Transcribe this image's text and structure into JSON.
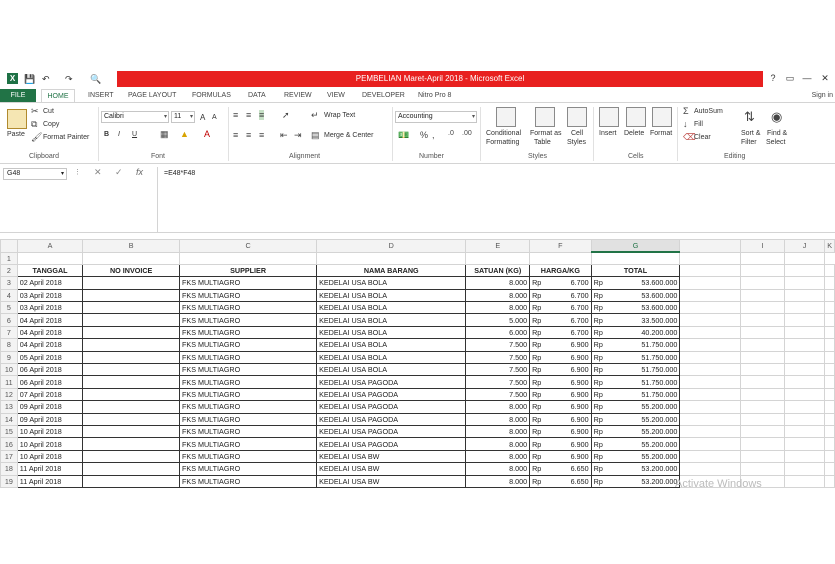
{
  "window": {
    "title": "PEMBELIAN Maret-April 2018 -  Microsoft Excel",
    "help": "?",
    "controls": {
      "restore": "▭",
      "minimize": "—",
      "maximize": "□",
      "close": "✕"
    }
  },
  "tabs": [
    "FILE",
    "HOME",
    "INSERT",
    "PAGE LAYOUT",
    "FORMULAS",
    "DATA",
    "REVIEW",
    "VIEW",
    "DEVELOPER",
    "Nitro Pro 8"
  ],
  "signin": "Sign in",
  "ribbon": {
    "clipboard": {
      "paste": "Paste",
      "cut": "Cut",
      "copy": "Copy",
      "format_painter": "Format Painter",
      "label": "Clipboard"
    },
    "font": {
      "name": "Calibri",
      "size": "11",
      "bold": "B",
      "italic": "I",
      "underline": "U",
      "grow": "A",
      "shrink": "A",
      "label": "Font"
    },
    "alignment": {
      "wrap": "Wrap Text",
      "merge": "Merge & Center",
      "label": "Alignment"
    },
    "number": {
      "format": "Accounting",
      "label": "Number"
    },
    "styles": {
      "conditional": "Conditional",
      "conditional2": "Formatting",
      "format_as": "Format as",
      "table": "Table",
      "cell": "Cell",
      "cell_styles": "Styles",
      "label": "Styles"
    },
    "cells": {
      "insert": "Insert",
      "delete": "Delete",
      "format": "Format",
      "label": "Cells"
    },
    "editing": {
      "autosum": "AutoSum",
      "fill": "Fill",
      "clear": "Clear",
      "sort": "Sort &",
      "filter": "Filter",
      "find": "Find &",
      "select": "Select",
      "label": "Editing"
    }
  },
  "formula_bar": {
    "name_box": "G48",
    "formula": "=E48*F48"
  },
  "columns": [
    "A",
    "B",
    "C",
    "D",
    "E",
    "F",
    "G",
    "I",
    "J",
    "K"
  ],
  "headers": {
    "tanggal": "TANGGAL",
    "invoice": "NO INVOICE",
    "supplier": "SUPPLIER",
    "barang": "NAMA BARANG",
    "satuan": "SATUAN (KG)",
    "harga": "HARGA/KG",
    "total": "TOTAL"
  },
  "currency": "Rp",
  "rows": [
    {
      "n": "3",
      "tanggal": "02 April 2018",
      "supplier": "FKS MULTIAGRO",
      "barang": "KEDELAI USA BOLA",
      "satuan": "8.000",
      "harga": "6.700",
      "total": "53.600.000"
    },
    {
      "n": "4",
      "tanggal": "03 April 2018",
      "supplier": "FKS MULTIAGRO",
      "barang": "KEDELAI USA BOLA",
      "satuan": "8.000",
      "harga": "6.700",
      "total": "53.600.000"
    },
    {
      "n": "5",
      "tanggal": "03 April 2018",
      "supplier": "FKS MULTIAGRO",
      "barang": "KEDELAI USA BOLA",
      "satuan": "8.000",
      "harga": "6.700",
      "total": "53.600.000"
    },
    {
      "n": "6",
      "tanggal": "04 April 2018",
      "supplier": "FKS MULTIAGRO",
      "barang": "KEDELAI USA BOLA",
      "satuan": "5.000",
      "harga": "6.700",
      "total": "33.500.000"
    },
    {
      "n": "7",
      "tanggal": "04 April 2018",
      "supplier": "FKS MULTIAGRO",
      "barang": "KEDELAI USA BOLA",
      "satuan": "6.000",
      "harga": "6.700",
      "total": "40.200.000"
    },
    {
      "n": "8",
      "tanggal": "04 April 2018",
      "supplier": "FKS MULTIAGRO",
      "barang": "KEDELAI USA BOLA",
      "satuan": "7.500",
      "harga": "6.900",
      "total": "51.750.000"
    },
    {
      "n": "9",
      "tanggal": "05 April 2018",
      "supplier": "FKS MULTIAGRO",
      "barang": "KEDELAI USA BOLA",
      "satuan": "7.500",
      "harga": "6.900",
      "total": "51.750.000"
    },
    {
      "n": "10",
      "tanggal": "06 April 2018",
      "supplier": "FKS MULTIAGRO",
      "barang": "KEDELAI USA BOLA",
      "satuan": "7.500",
      "harga": "6.900",
      "total": "51.750.000"
    },
    {
      "n": "11",
      "tanggal": "06 April 2018",
      "supplier": "FKS MULTIAGRO",
      "barang": "KEDELAI USA PAGODA",
      "satuan": "7.500",
      "harga": "6.900",
      "total": "51.750.000"
    },
    {
      "n": "12",
      "tanggal": "07 April 2018",
      "supplier": "FKS MULTIAGRO",
      "barang": "KEDELAI USA PAGODA",
      "satuan": "7.500",
      "harga": "6.900",
      "total": "51.750.000"
    },
    {
      "n": "13",
      "tanggal": "09 April 2018",
      "supplier": "FKS MULTIAGRO",
      "barang": "KEDELAI USA PAGODA",
      "satuan": "8.000",
      "harga": "6.900",
      "total": "55.200.000"
    },
    {
      "n": "14",
      "tanggal": "09 April 2018",
      "supplier": "FKS MULTIAGRO",
      "barang": "KEDELAI USA PAGODA",
      "satuan": "8.000",
      "harga": "6.900",
      "total": "55.200.000"
    },
    {
      "n": "15",
      "tanggal": "10 April 2018",
      "supplier": "FKS MULTIAGRO",
      "barang": "KEDELAI USA PAGODA",
      "satuan": "8.000",
      "harga": "6.900",
      "total": "55.200.000"
    },
    {
      "n": "16",
      "tanggal": "10 April 2018",
      "supplier": "FKS MULTIAGRO",
      "barang": "KEDELAI USA PAGODA",
      "satuan": "8.000",
      "harga": "6.900",
      "total": "55.200.000"
    },
    {
      "n": "17",
      "tanggal": "10 April 2018",
      "supplier": "FKS MULTIAGRO",
      "barang": "KEDELAI USA BW",
      "satuan": "8.000",
      "harga": "6.900",
      "total": "55.200.000"
    },
    {
      "n": "18",
      "tanggal": "11 April 2018",
      "supplier": "FKS MULTIAGRO",
      "barang": "KEDELAI USA BW",
      "satuan": "8.000",
      "harga": "6.650",
      "total": "53.200.000"
    },
    {
      "n": "19",
      "tanggal": "11 April 2018",
      "supplier": "FKS MULTIAGRO",
      "barang": "KEDELAI USA BW",
      "satuan": "8.000",
      "harga": "6.650",
      "total": "53.200.000"
    }
  ],
  "watermark": "Activate Windows",
  "colors": {
    "excel_green": "#217346",
    "title_red": "#e8201f"
  }
}
